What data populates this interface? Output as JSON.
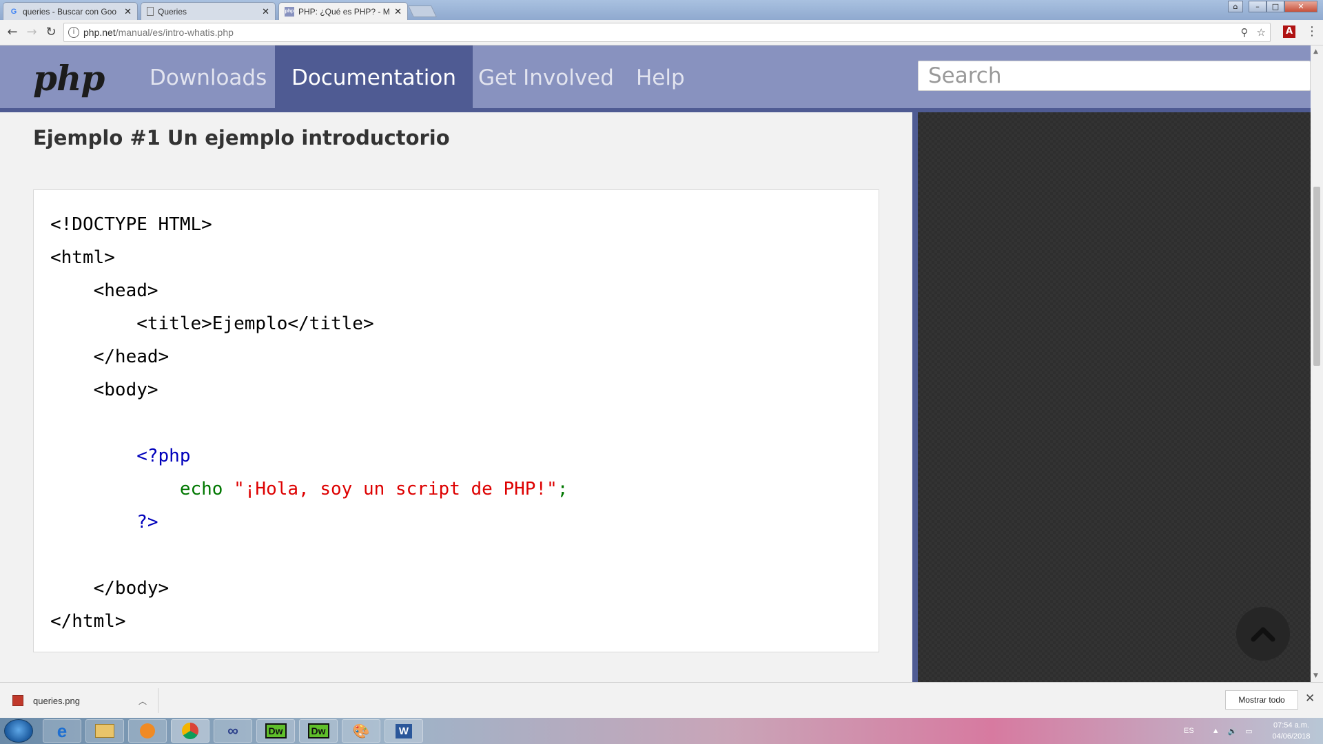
{
  "browser": {
    "tabs": [
      {
        "title": "queries - Buscar con Goo",
        "favicon": "G"
      },
      {
        "title": "Queries",
        "favicon": "doc"
      },
      {
        "title": "PHP: ¿Qué es PHP? - Ma",
        "favicon": "php"
      }
    ],
    "url_host": "php.net",
    "url_path": "/manual/es/intro-whatis.php"
  },
  "site": {
    "logo": "php",
    "nav": [
      "Downloads",
      "Documentation",
      "Get Involved",
      "Help"
    ],
    "active_nav": "Documentation",
    "search_placeholder": "Search"
  },
  "content": {
    "example_title": "Ejemplo #1 Un ejemplo introductorio",
    "code": {
      "l1": "<!DOCTYPE HTML>",
      "l2": "<html>",
      "l3": "    <head>",
      "l4": "        <title>Ejemplo</title>",
      "l5": "    </head>",
      "l6": "    <body>",
      "l8": "        <?php",
      "l9_indent": "            ",
      "l9_kw": "echo ",
      "l9_str": "\"¡Hola, soy un script de PHP!\"",
      "l9_end": ";",
      "l10": "        ?>",
      "l12": "    </body>",
      "l13": "</html>"
    }
  },
  "downloads": {
    "file": "queries.png",
    "show_all": "Mostrar todo"
  },
  "taskbar": {
    "language": "ES",
    "time": "07:54 a.m.",
    "date": "04/06/2018"
  },
  "colors": {
    "php_header": "#8892bf",
    "php_header_dark": "#4f5b93",
    "code_php_tag": "#0000bb",
    "code_keyword": "#007700",
    "code_string": "#dd0000"
  }
}
